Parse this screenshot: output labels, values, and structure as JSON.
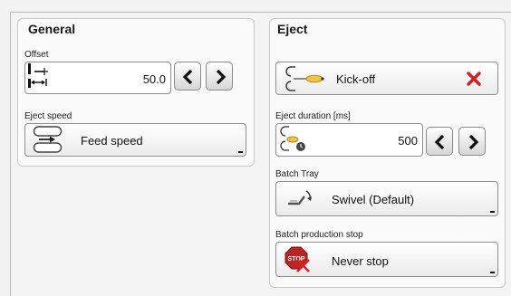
{
  "general": {
    "title": "General",
    "offset": {
      "label": "Offset",
      "value": "50.0"
    },
    "eject_speed": {
      "label": "Eject speed",
      "selected": "Feed speed"
    }
  },
  "eject": {
    "title": "Eject",
    "action": {
      "label": "Kick-off"
    },
    "duration": {
      "label": "Eject duration [ms]",
      "value": "500"
    },
    "batch_tray": {
      "label": "Batch Tray",
      "selected": "Swivel (Default)"
    },
    "batch_stop": {
      "label": "Batch production stop",
      "selected": "Never stop",
      "icon_text": "STOP"
    }
  },
  "icons": {
    "offset": "offset-icon",
    "eject_speed": "feed-speed-icon",
    "kickoff": "kick-off-icon",
    "remove": "red-x-icon",
    "duration": "eject-duration-icon",
    "tray": "swivel-tray-icon",
    "stop": "stop-sign-icon",
    "prev": "chevron-left-icon",
    "next": "chevron-right-icon"
  },
  "colors": {
    "remove": "#d42020",
    "stop": "#b52727"
  }
}
